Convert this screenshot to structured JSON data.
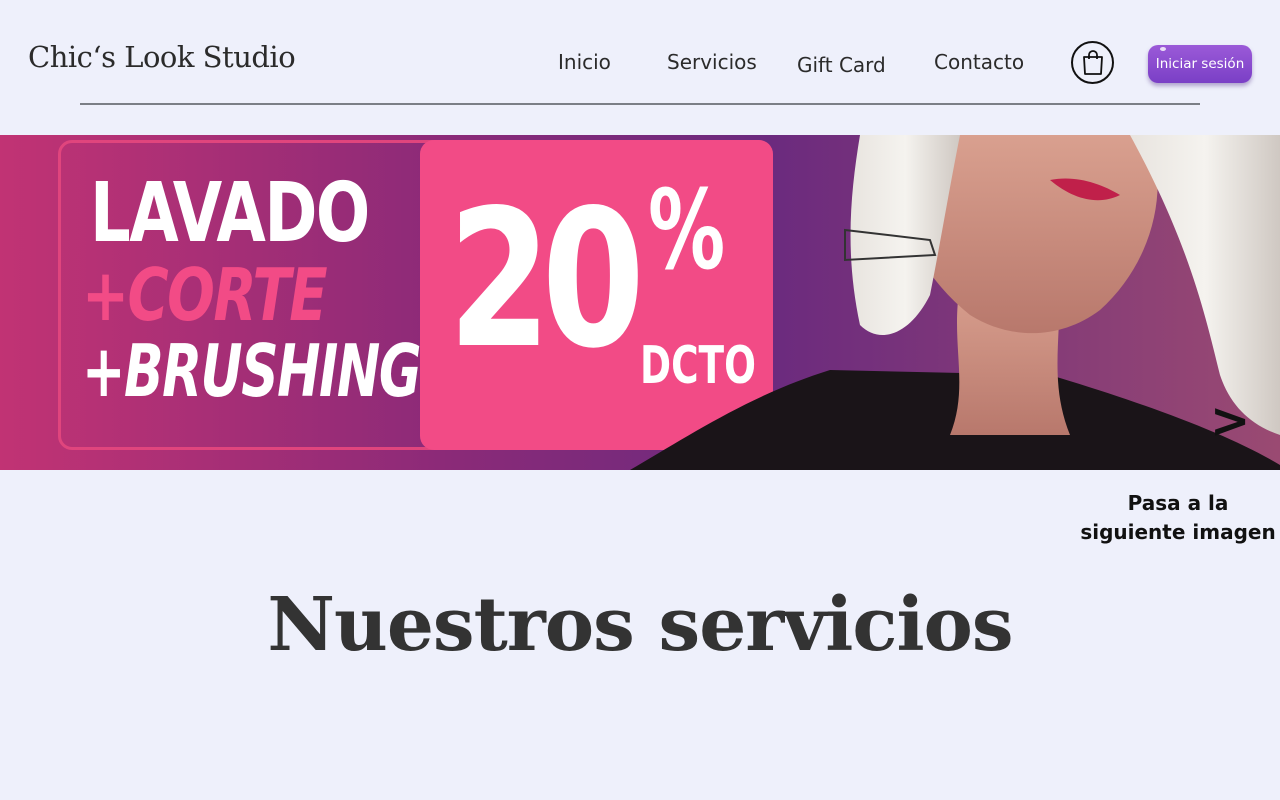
{
  "header": {
    "logo": "Chic‘s Look Studio",
    "nav": [
      {
        "label": "Inicio"
      },
      {
        "label": "Servicios"
      },
      {
        "label": "Gift Card"
      },
      {
        "label": "Contacto"
      }
    ],
    "cart_icon": "shopping-bag-icon",
    "login_label": "Iniciar sesión"
  },
  "banner": {
    "line1": "LAVADO",
    "line2": "+CORTE",
    "line3": "+BRUSHING",
    "discount": "20",
    "percent": "%",
    "dcto": "DCTO",
    "next_arrow": ">",
    "next_caption": "Pasa a la siguiente imagen"
  },
  "colors": {
    "background": "#eef0fb",
    "accent_pink": "#f24b86",
    "login_button": "#8a4bd0"
  },
  "main": {
    "section_title": "Nuestros servicios"
  }
}
